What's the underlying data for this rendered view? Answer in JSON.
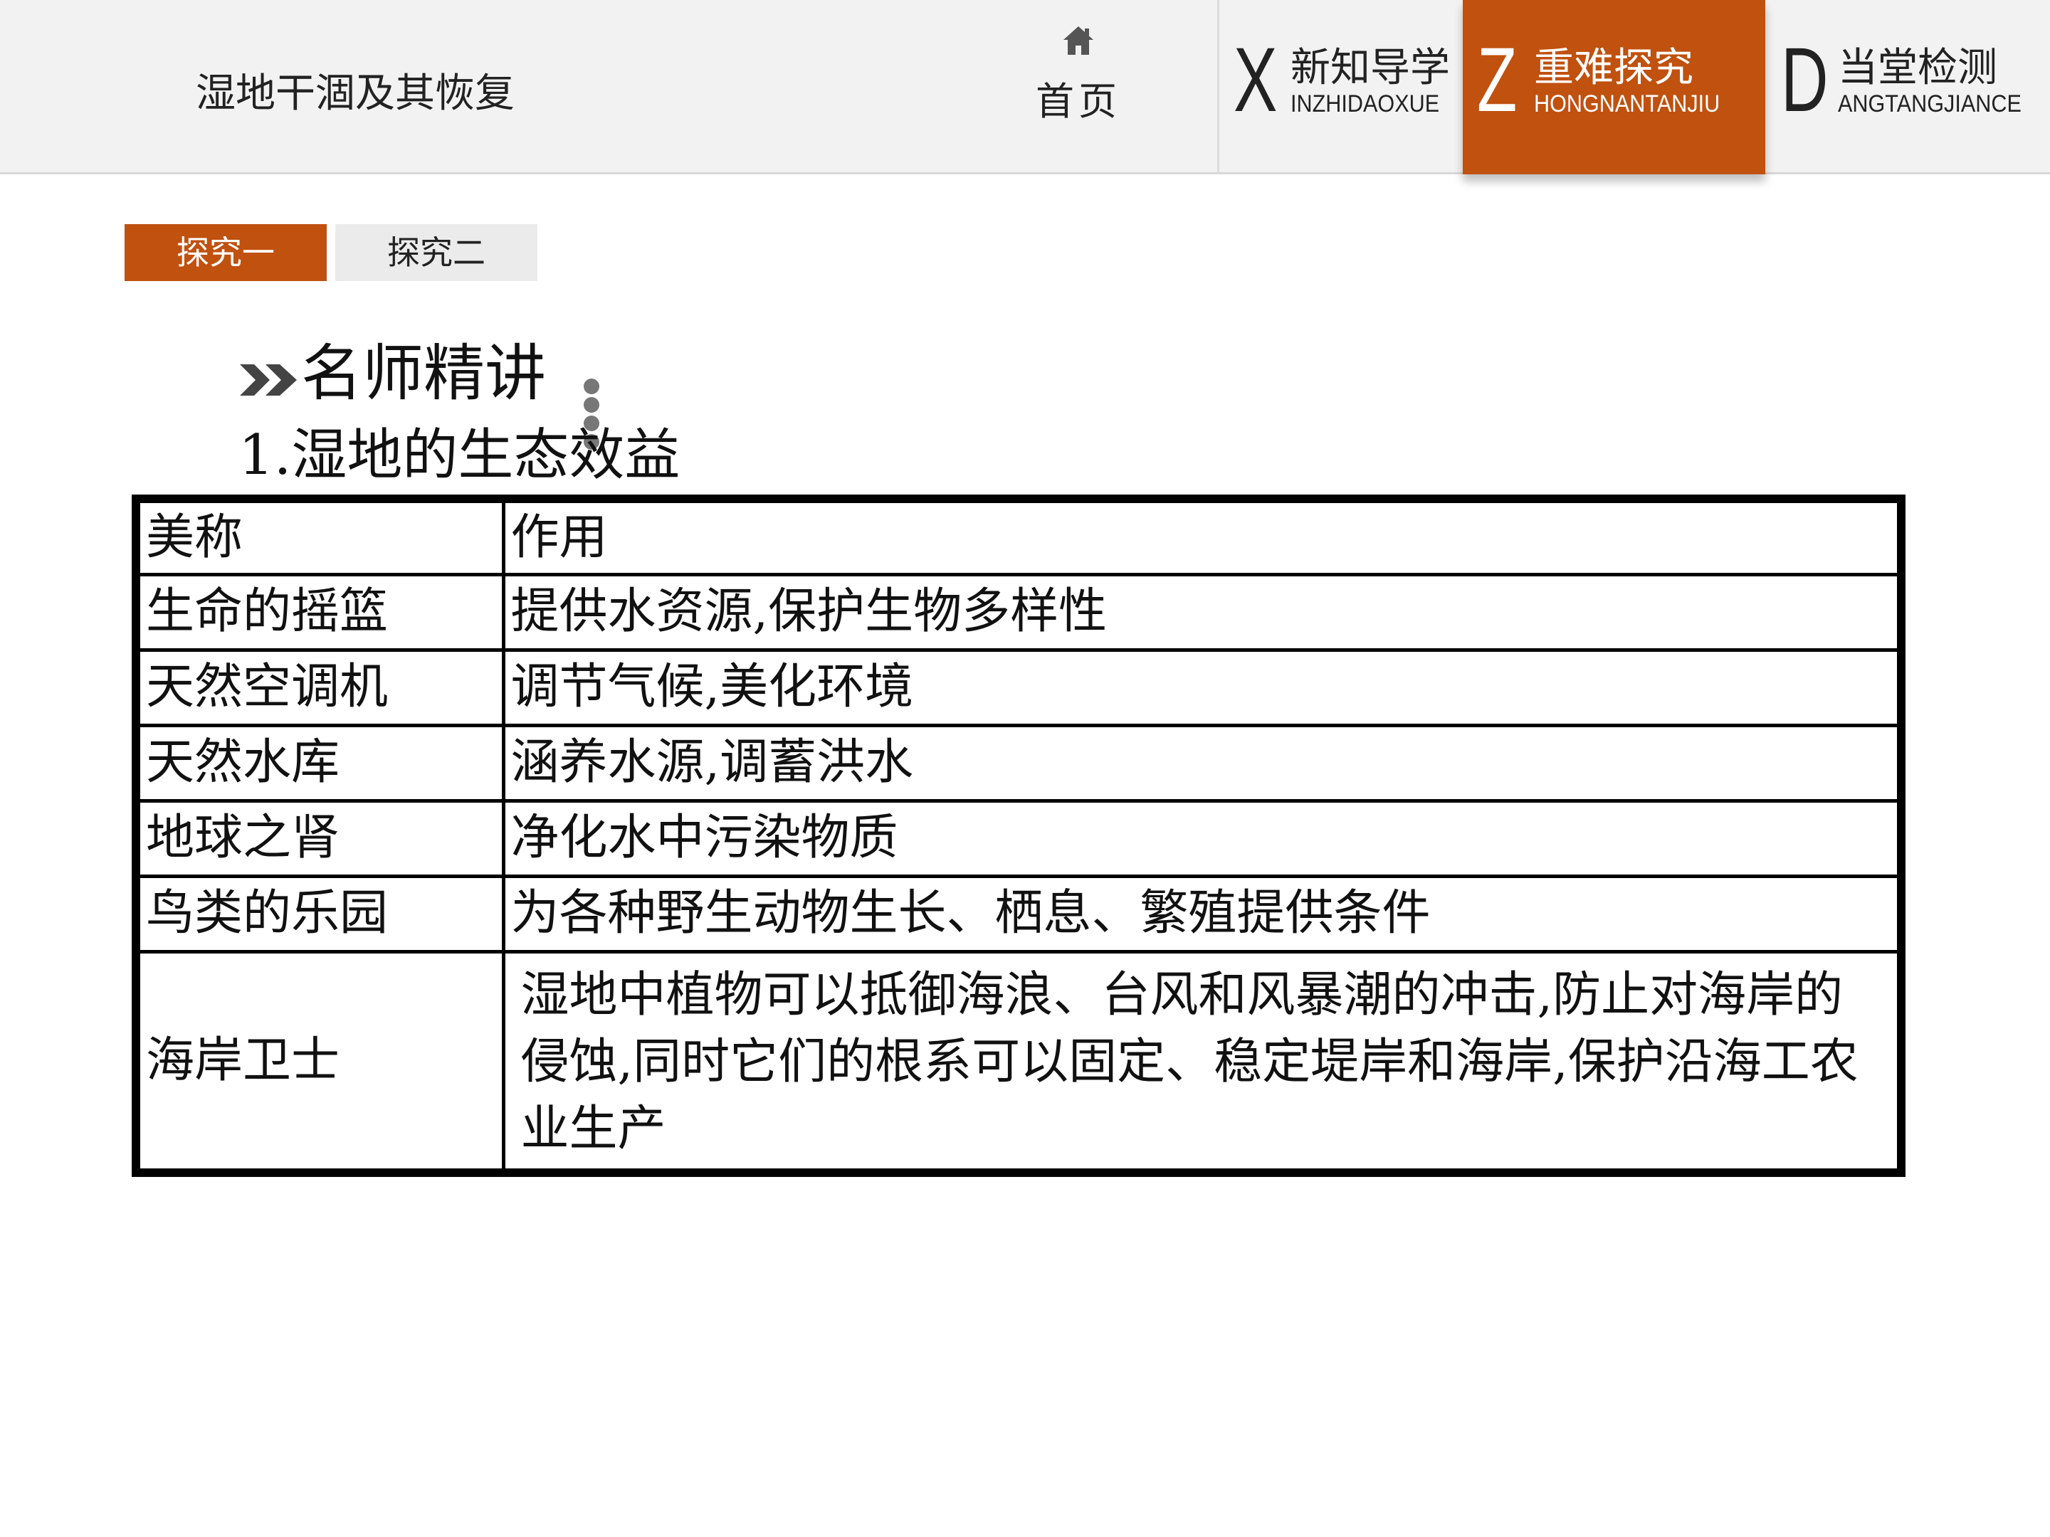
{
  "header": {
    "page_title": "湿地干涸及其恢复",
    "home_label": "首页",
    "nav_tabs": [
      {
        "letter": "X",
        "cn": "新知导学",
        "en": "INZHIDAOXUE",
        "active": false
      },
      {
        "letter": "Z",
        "cn": "重难探究",
        "en": "HONGNANTANJIU",
        "active": true
      },
      {
        "letter": "D",
        "cn": "当堂检测",
        "en": "ANGTANGJIANCE",
        "active": false
      }
    ]
  },
  "subtabs": [
    {
      "label": "探究一",
      "active": true
    },
    {
      "label": "探究二",
      "active": false
    }
  ],
  "section": {
    "heading": "名师精讲",
    "subtitle": "1.湿地的生态效益"
  },
  "table": {
    "headers": [
      "美称",
      "作用"
    ],
    "rows": [
      [
        "生命的摇篮",
        "提供水资源,保护生物多样性"
      ],
      [
        "天然空调机",
        "调节气候,美化环境"
      ],
      [
        "天然水库",
        "涵养水源,调蓄洪水"
      ],
      [
        "地球之肾",
        "净化水中污染物质"
      ],
      [
        "鸟类的乐园",
        "为各种野生动物生长、栖息、繁殖提供条件"
      ],
      [
        "海岸卫士",
        "湿地中植物可以抵御海浪、台风和风暴潮的冲击,防止对海岸的侵蚀,同时它们的根系可以固定、稳定堤岸和海岸,保护沿海工农业生产"
      ]
    ]
  },
  "colors": {
    "accent": "#c0510f",
    "topbar_bg": "#f2f2f2",
    "inactive_tab_bg": "#ebebeb"
  },
  "icons": {
    "home": "home-icon",
    "heading_marker": "double-chevron-right-icon"
  }
}
